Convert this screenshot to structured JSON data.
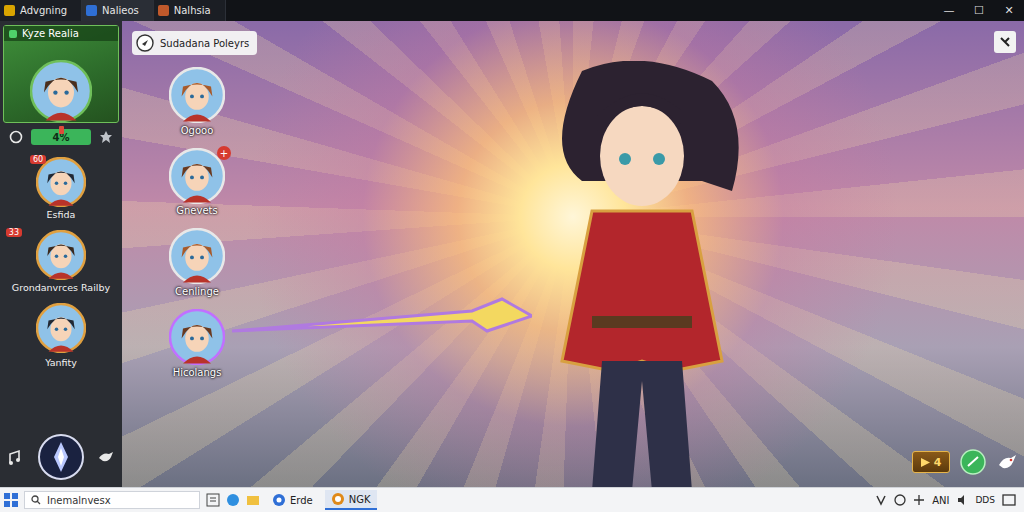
{
  "window": {
    "tabs": [
      {
        "label": "Advgning",
        "selected": false,
        "color": "#d9a400"
      },
      {
        "label": "Nalieos",
        "selected": true,
        "color": "#2f6fd6"
      },
      {
        "label": "Nalhsia",
        "selected": false,
        "color": "#c0592b"
      }
    ],
    "controls": [
      "—",
      "☐",
      "✕"
    ]
  },
  "profile": {
    "name": "Kyze Realia",
    "progress": "4%"
  },
  "friends": [
    {
      "name": "Esfida",
      "badge": "60"
    },
    {
      "name": "Grondanvrces Railby",
      "badge": "33"
    },
    {
      "name": "Yanfity",
      "badge": ""
    }
  ],
  "players": {
    "title": "Sudadana Poleyrs",
    "items": [
      {
        "name": "Ogooo",
        "badge": "",
        "selected": false
      },
      {
        "name": "Gnevets",
        "badge": "+",
        "selected": false
      },
      {
        "name": "Cenlinge",
        "badge": "",
        "selected": false
      },
      {
        "name": "Hicolangs",
        "badge": "",
        "selected": true
      }
    ]
  },
  "hud": {
    "count": "4"
  },
  "taskbar": {
    "search": "Inemalnvesx",
    "apps": [
      {
        "label": "Erde",
        "selected": false
      },
      {
        "label": "NGK",
        "selected": true
      }
    ],
    "tray": "ANI",
    "clock": "DDS"
  }
}
